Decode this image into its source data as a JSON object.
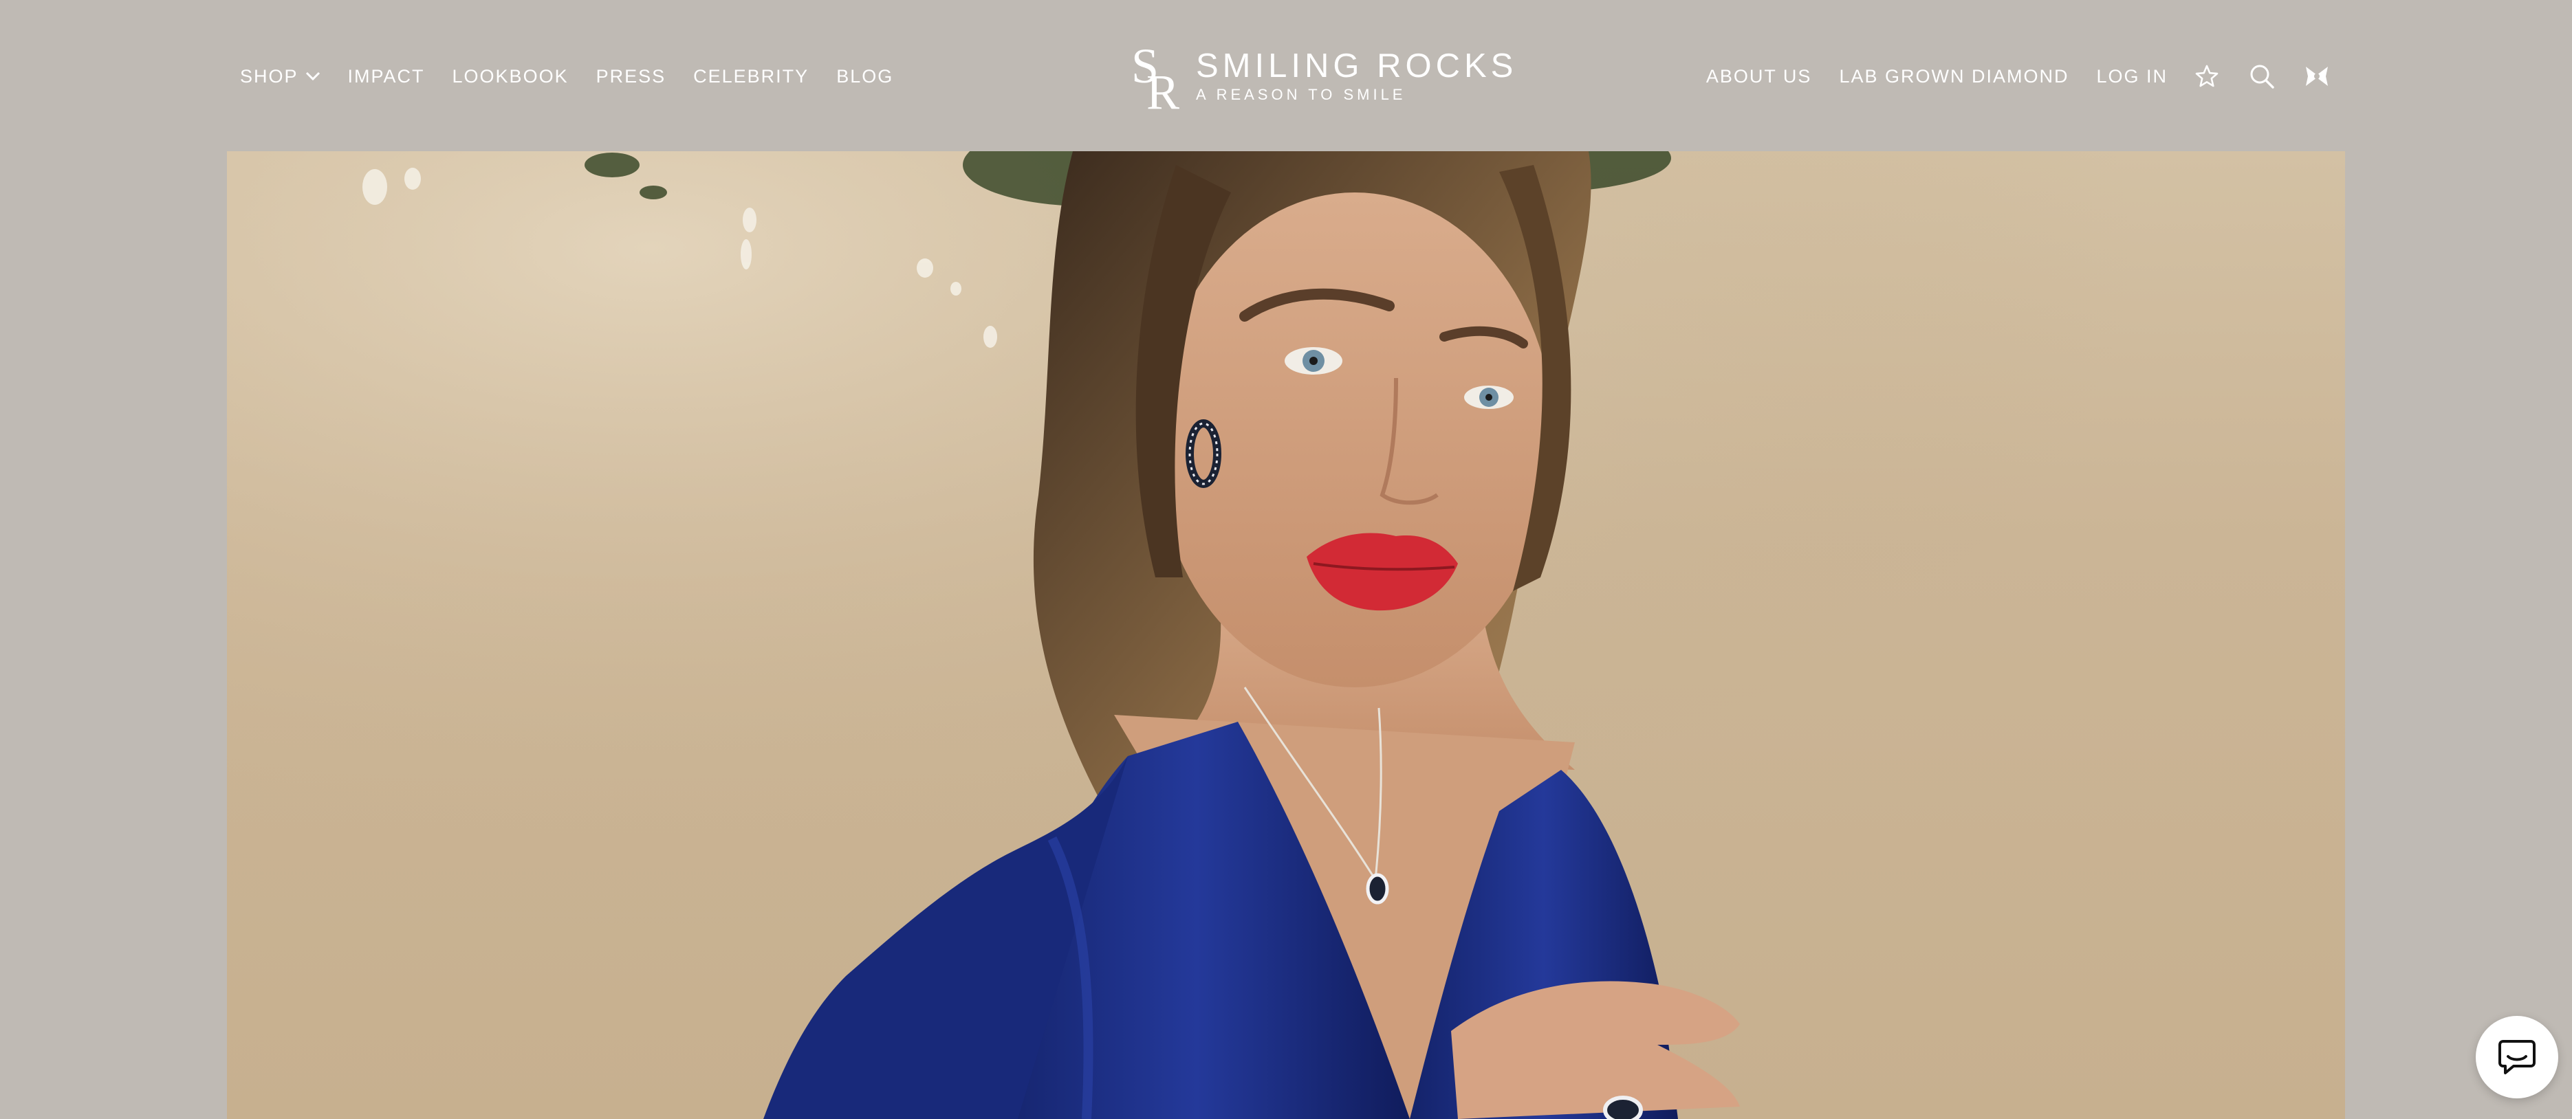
{
  "brand": {
    "name": "SMILING ROCKS",
    "tagline": "A REASON TO SMILE",
    "monogram": "SR"
  },
  "nav_left": {
    "shop": "SHOP",
    "impact": "IMPACT",
    "lookbook": "LOOKBOOK",
    "press": "PRESS",
    "celebrity": "CELEBRITY",
    "blog": "BLOG"
  },
  "nav_right": {
    "about": "ABOUT US",
    "lab_grown": "LAB GROWN DIAMOND",
    "login": "LOG IN"
  },
  "icons": {
    "shop_dropdown": "chevron-down-icon",
    "wishlist": "star-icon",
    "search": "search-icon",
    "cart": "bow-cart-icon",
    "chat": "chat-bubble-icon"
  },
  "colors": {
    "header_bg": "#bfbab4",
    "nav_text": "#ffffff",
    "hero_wall": "#cbb596",
    "dress_blue": "#1d2f7a",
    "lip_red": "#d22a35"
  }
}
